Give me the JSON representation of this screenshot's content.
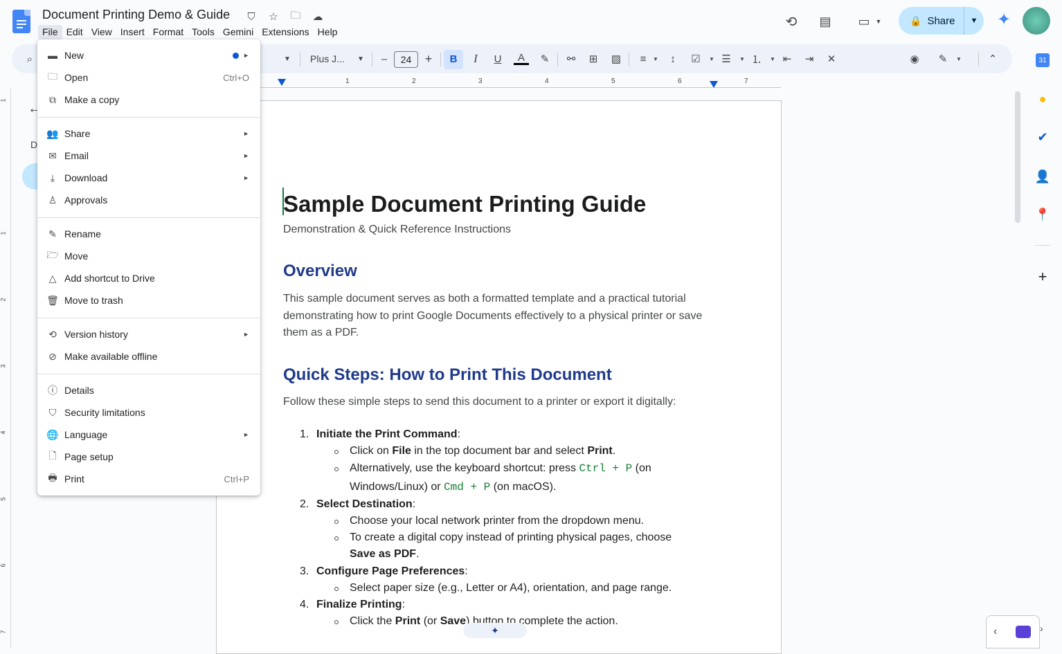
{
  "header": {
    "title": "Document Printing Demo & Guide",
    "menus": [
      "File",
      "Edit",
      "View",
      "Insert",
      "Format",
      "Tools",
      "Gemini",
      "Extensions",
      "Help"
    ],
    "share_label": "Share"
  },
  "toolbar": {
    "font_name": "Plus J...",
    "font_size": "24"
  },
  "ruler": {
    "numbers": [
      "1",
      "2",
      "3",
      "4",
      "5",
      "6",
      "7"
    ],
    "vertical_numbers": [
      "1",
      "1",
      "2",
      "3",
      "4",
      "5",
      "6",
      "7"
    ]
  },
  "outline": {
    "label": "D"
  },
  "file_menu": {
    "items": [
      {
        "label": "New",
        "shortcut": "",
        "submenu": true,
        "icon": "new-doc-icon"
      },
      {
        "label": "Open",
        "shortcut": "Ctrl+O",
        "submenu": false,
        "icon": "folder-icon"
      },
      {
        "label": "Make a copy",
        "shortcut": "",
        "submenu": false,
        "icon": "copy-icon"
      },
      {
        "label": "Share",
        "shortcut": "",
        "submenu": true,
        "icon": "person-add-icon"
      },
      {
        "label": "Email",
        "shortcut": "",
        "submenu": true,
        "icon": "mail-icon"
      },
      {
        "label": "Download",
        "shortcut": "",
        "submenu": true,
        "icon": "download-icon"
      },
      {
        "label": "Approvals",
        "shortcut": "",
        "submenu": false,
        "icon": "approval-icon"
      },
      {
        "label": "Rename",
        "shortcut": "",
        "submenu": false,
        "icon": "pencil-icon"
      },
      {
        "label": "Move",
        "shortcut": "",
        "submenu": false,
        "icon": "move-folder-icon"
      },
      {
        "label": "Add shortcut to Drive",
        "shortcut": "",
        "submenu": false,
        "icon": "drive-shortcut-icon"
      },
      {
        "label": "Move to trash",
        "shortcut": "",
        "submenu": false,
        "icon": "trash-icon"
      },
      {
        "label": "Version history",
        "shortcut": "",
        "submenu": true,
        "icon": "history-icon"
      },
      {
        "label": "Make available offline",
        "shortcut": "",
        "submenu": false,
        "icon": "offline-icon"
      },
      {
        "label": "Details",
        "shortcut": "",
        "submenu": false,
        "icon": "info-icon"
      },
      {
        "label": "Security limitations",
        "shortcut": "",
        "submenu": false,
        "icon": "shield-icon"
      },
      {
        "label": "Language",
        "shortcut": "",
        "submenu": true,
        "icon": "globe-icon"
      },
      {
        "label": "Page setup",
        "shortcut": "",
        "submenu": false,
        "icon": "page-icon"
      },
      {
        "label": "Print",
        "shortcut": "Ctrl+P",
        "submenu": false,
        "icon": "printer-icon"
      }
    ]
  },
  "document": {
    "title": "Sample Document Printing Guide",
    "subtitle": "Demonstration & Quick Reference Instructions",
    "overview_heading": "Overview",
    "overview_text": "This sample document serves as both a formatted template and a practical tutorial demonstrating how to print Google Documents effectively to a physical printer or save them as a PDF.",
    "steps_heading": "Quick Steps: How to Print This Document",
    "steps_intro": "Follow these simple steps to send this document to a printer or export it digitally:",
    "step1_num": "1.",
    "step1_title": "Initiate the Print Command",
    "step1_a_pre": "Click on ",
    "step1_a_b1": "File",
    "step1_a_mid": " in the top document bar and select ",
    "step1_a_b2": "Print",
    "step1_a_post": ".",
    "step1_b_pre": "Alternatively, use the keyboard shortcut: press ",
    "step1_b_code1": "Ctrl + P",
    "step1_b_mid": " (on",
    "step1_b_line2_pre": "Windows/Linux) or ",
    "step1_b_code2": "Cmd + P",
    "step1_b_post": " (on macOS).",
    "step2_num": "2.",
    "step2_title": "Select Destination",
    "step2_a": "Choose your local network printer from the dropdown menu.",
    "step2_b": "To create a digital copy instead of printing physical pages, choose",
    "step2_b_bold": "Save as PDF",
    "step2_b_post": ".",
    "step3_num": "3.",
    "step3_title": "Configure Page Preferences",
    "step3_a": "Select paper size (e.g., Letter or A4), orientation, and page range.",
    "step4_num": "4.",
    "step4_title": "Finalize Printing",
    "step4_a_pre": "Click the ",
    "step4_a_b1": "Print",
    "step4_a_mid": " (or ",
    "step4_a_b2": "Save",
    "step4_a_post": ") button to complete the action.",
    "colon": ":"
  },
  "colors": {
    "accent": "#0b57d0",
    "heading": "#1f3a8a",
    "share_bg": "#c2e7ff"
  }
}
